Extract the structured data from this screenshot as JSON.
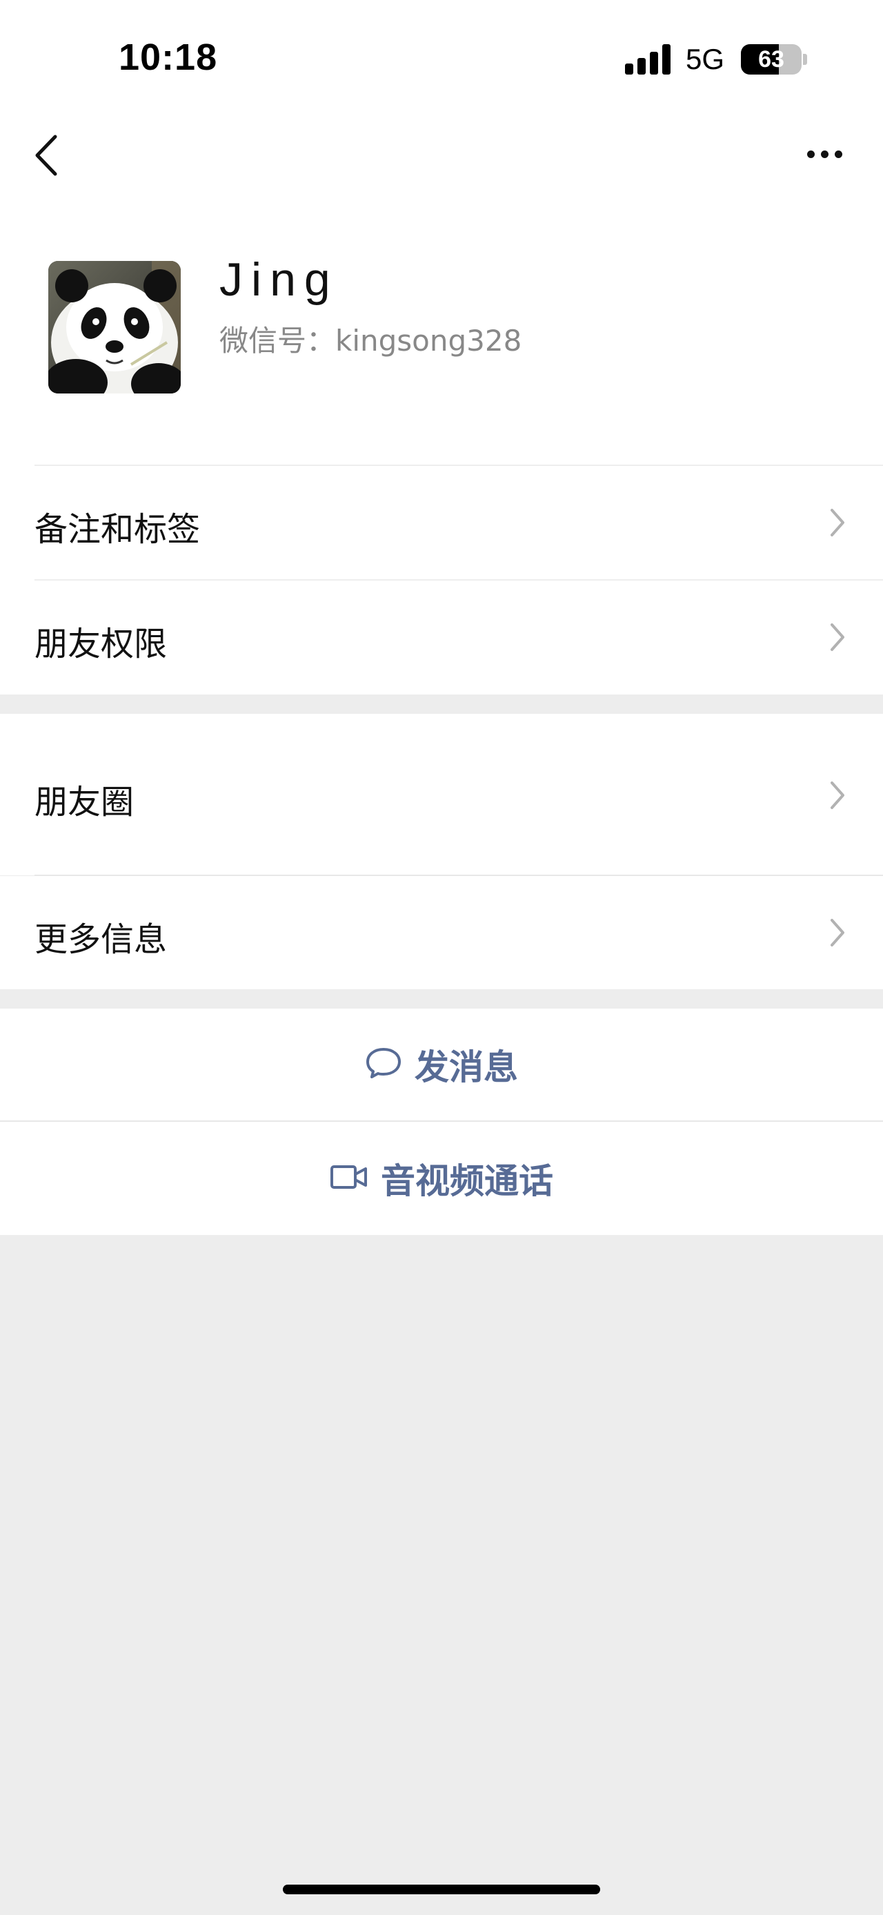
{
  "status_bar": {
    "time": "10:18",
    "network": "5G",
    "battery": "63",
    "battery_level": 0.63
  },
  "nav": {
    "back_icon": "chevron-left-icon",
    "more_icon": "ellipsis-icon"
  },
  "profile": {
    "name": "Jing",
    "wechat_id": "微信号：kingsong328",
    "avatar": "panda-avatar"
  },
  "group1": [
    {
      "label": "备注和标签"
    },
    {
      "label": "朋友权限"
    }
  ],
  "group2": [
    {
      "label": "朋友圈"
    },
    {
      "label": "更多信息"
    }
  ],
  "actions": {
    "message": {
      "label": "发消息",
      "icon": "chat-bubble-icon"
    },
    "call": {
      "label": "音视频通话",
      "icon": "video-camera-icon"
    }
  },
  "colors": {
    "accent": "#576b95",
    "background": "#ededed",
    "card": "#ffffff"
  }
}
